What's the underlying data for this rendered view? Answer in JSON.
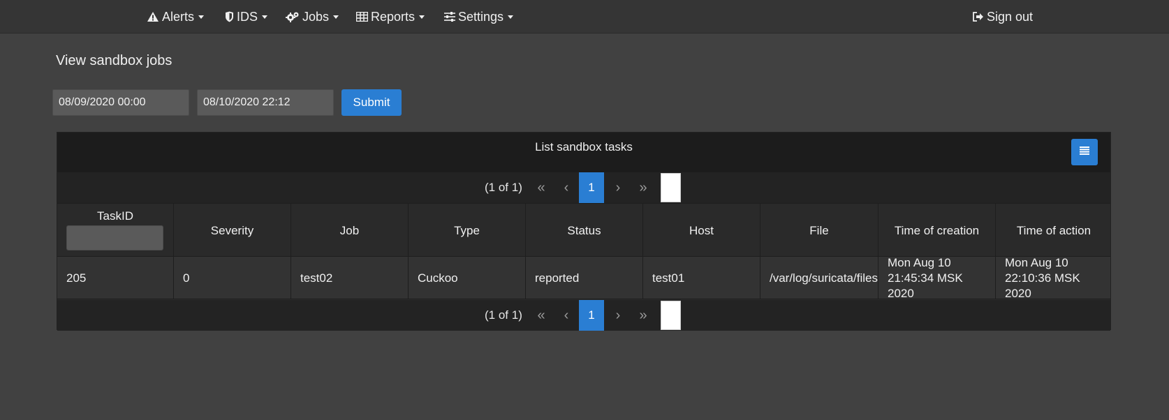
{
  "nav": {
    "alerts": "Alerts",
    "ids": "IDS",
    "jobs": "Jobs",
    "reports": "Reports",
    "settings": "Settings",
    "signout": "Sign out"
  },
  "page": {
    "title": "View sandbox jobs"
  },
  "filter": {
    "from_value": "08/09/2020 00:00",
    "to_value": "08/10/2020 22:12",
    "submit_label": "Submit"
  },
  "panel": {
    "title": "List sandbox tasks"
  },
  "paginator": {
    "count": "(1 of 1)",
    "first": "«",
    "prev": "‹",
    "page": "1",
    "next": "›",
    "last": "»"
  },
  "table": {
    "columns": [
      "TaskID",
      "Severity",
      "Job",
      "Type",
      "Status",
      "Host",
      "File",
      "Time of creation",
      "Time of action"
    ],
    "rows": [
      {
        "task_id": "205",
        "severity": "0",
        "job": "test02",
        "type": "Cuckoo",
        "status": "reported",
        "host": "test01",
        "file": "/var/log/suricata/files",
        "time_of_creation": "Mon Aug 10 21:45:34 MSK 2020",
        "time_of_action": "Mon Aug 10 22:10:36 MSK 2020"
      }
    ]
  },
  "colors": {
    "accent": "#2a7ed3",
    "background": "#414141",
    "navbar": "#353535"
  }
}
